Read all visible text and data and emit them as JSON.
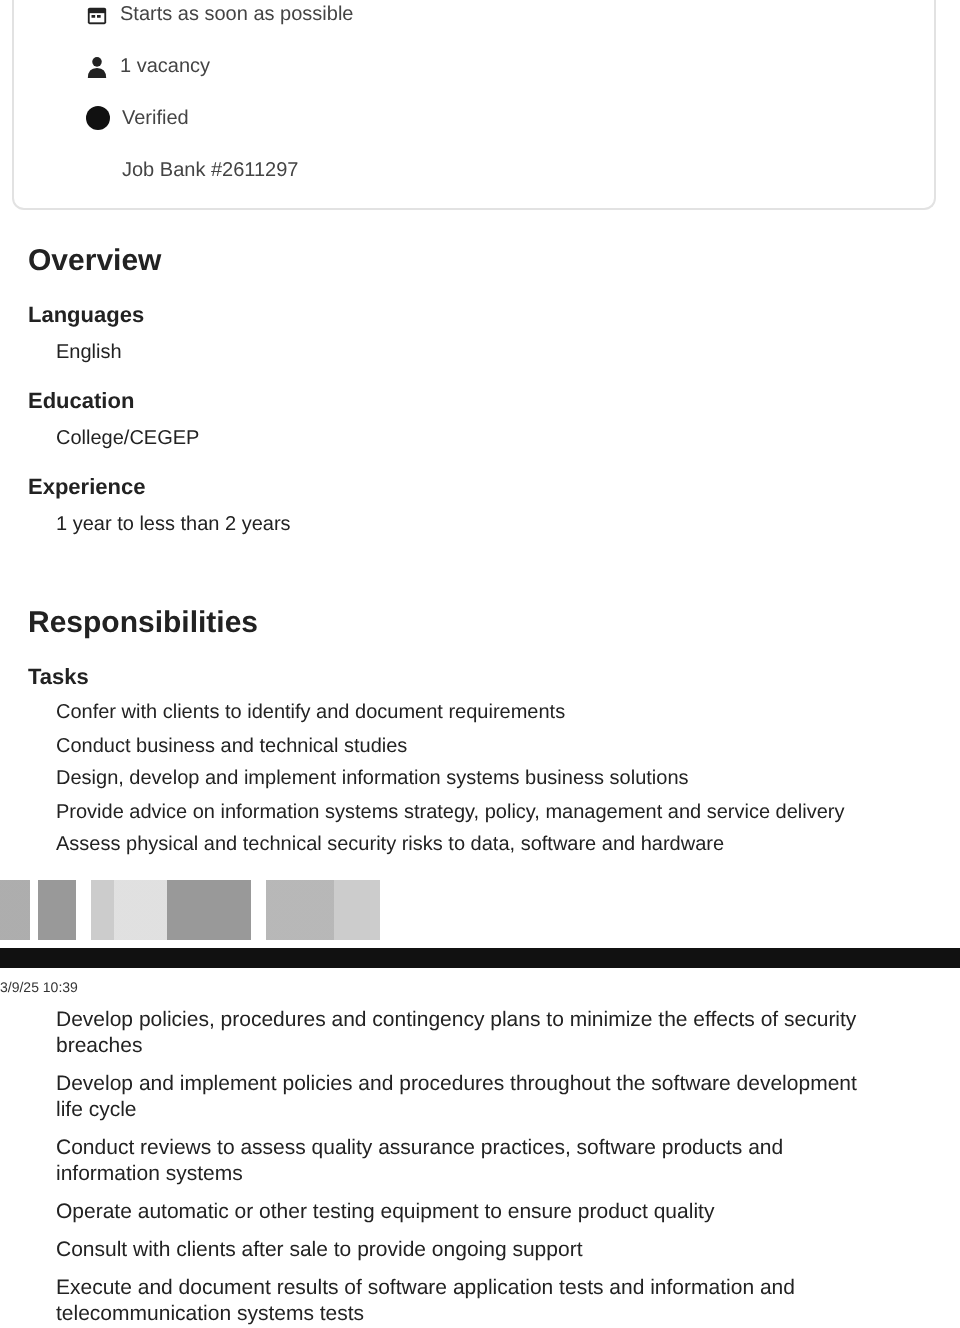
{
  "job_card": {
    "items": [
      {
        "kind": "calendar",
        "text": "Starts as soon as possible"
      },
      {
        "kind": "person",
        "text": "1 vacancy"
      },
      {
        "kind": "verified",
        "text": "Verified"
      },
      {
        "kind": "plain",
        "text": "Job Bank #2611297"
      }
    ]
  },
  "overview": {
    "title": "Overview",
    "sections": [
      {
        "label": "Languages",
        "value": "English"
      },
      {
        "label": "Education",
        "value": "College/CEGEP"
      },
      {
        "label": "Experience",
        "value": "1 year to less than 2 years"
      }
    ]
  },
  "responsibilities": {
    "title": "Responsibilities",
    "subtitle": "Tasks",
    "tasks": [
      "Confer with clients to identify and document requirements",
      "Conduct business and technical studies",
      "Design, develop and implement information systems business solutions",
      "Provide advice on information systems strategy, policy, management and service delivery",
      "Assess physical and technical security risks to data, software and hardware"
    ]
  },
  "second_screenshot": {
    "timestamp": "3/9/25 10:39",
    "tasks": [
      "Develop policies, procedures and contingency plans to minimize the effects of security breaches",
      "Develop and implement policies and procedures throughout the software development life cycle",
      "Conduct reviews to assess quality assurance practices, software products and information systems",
      "Operate automatic or other testing equipment to ensure product quality",
      "Consult with clients after sale to provide ongoing support",
      "Execute and document results of software application tests and information and telecommunication systems tests"
    ]
  }
}
